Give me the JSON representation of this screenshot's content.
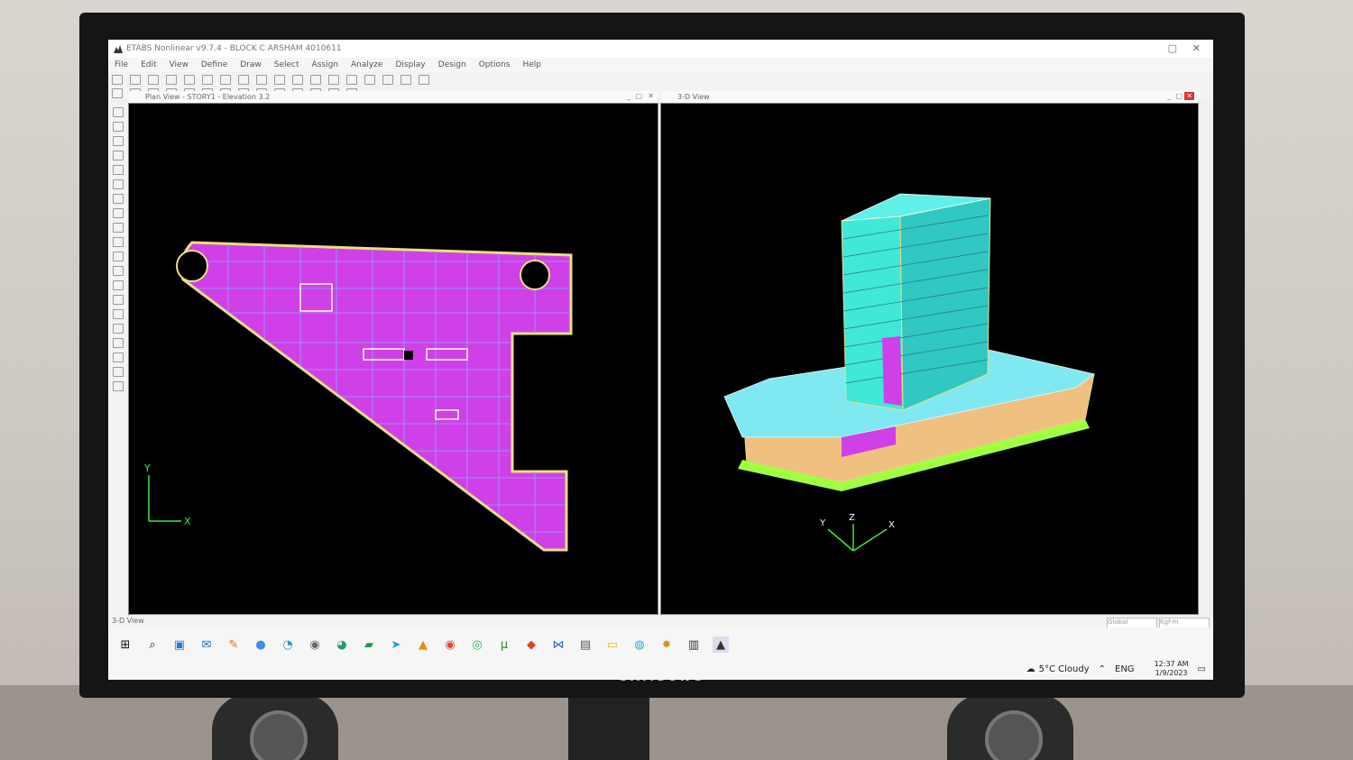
{
  "window": {
    "title": "ETABS Nonlinear v9.7.4 - BLOCK C ARSHAM 4010611",
    "menu": [
      "File",
      "Edit",
      "View",
      "Define",
      "Draw",
      "Select",
      "Assign",
      "Analyze",
      "Display",
      "Design",
      "Options",
      "Help"
    ]
  },
  "plan_view": {
    "title": "Plan View - STORY1 - Elevation 3.2",
    "axis_x": "X",
    "axis_y": "Y"
  },
  "view3d": {
    "title": "3-D View",
    "axis_x": "X",
    "axis_y": "Y",
    "axis_z": "Z"
  },
  "status": {
    "left": "3-D View",
    "global": "Global",
    "units": "Kgf-m"
  },
  "taskbar": {
    "weather": "5°C Cloudy",
    "language": "ENG",
    "time": "12:37 AM",
    "date": "1/9/2023",
    "icons": [
      "windows-icon",
      "search-icon",
      "taskview-icon",
      "mail-icon",
      "pencil-icon",
      "chat-icon",
      "edge-icon",
      "chrome-icon",
      "edge-dev-icon",
      "project-icon",
      "telegram-icon",
      "vlc-icon",
      "chrome-icon",
      "whatsapp-icon",
      "utorrent-icon",
      "diamond-icon",
      "vscode-icon",
      "calculator-icon",
      "folder-icon",
      "globe-icon",
      "paint-icon",
      "city-icon",
      "etabs-icon"
    ]
  },
  "monitor": {
    "brand": "SAMSUNG"
  },
  "colors": {
    "slab": "#d040e8",
    "beam": "#e8e080",
    "grid": "#80c0ff",
    "tower": "#40e8d8",
    "podium": "#f0c080"
  }
}
